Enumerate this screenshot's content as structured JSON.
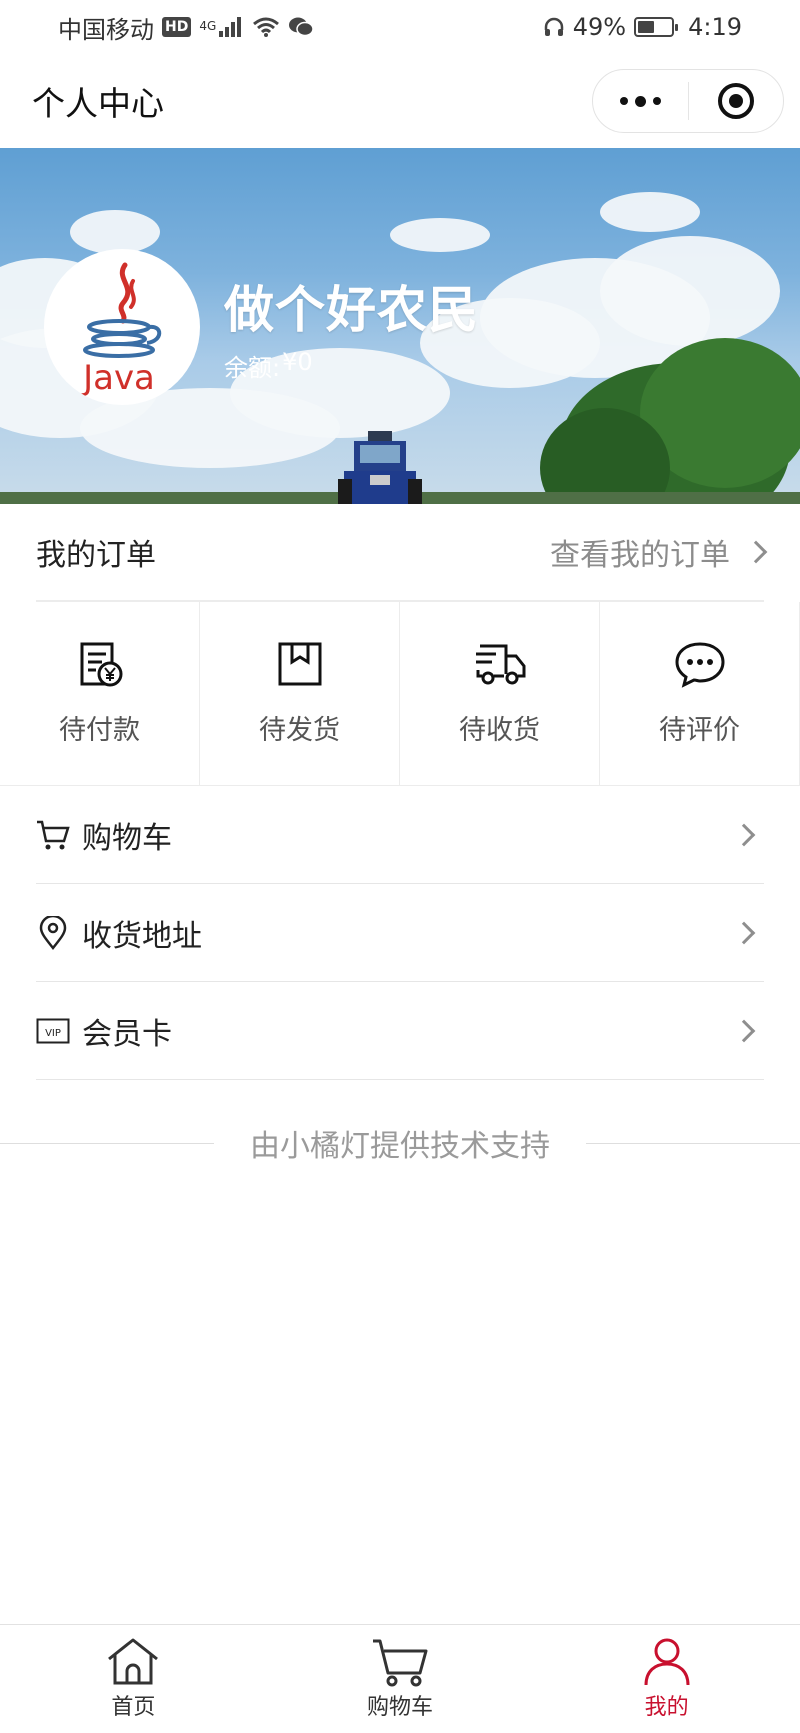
{
  "status_bar": {
    "carrier": "中国移动",
    "hd": "HD",
    "network": "4G",
    "battery": "49%",
    "battery_level": 0.49,
    "time": "4:19"
  },
  "nav": {
    "title": "个人中心"
  },
  "profile": {
    "avatar_text": "Java",
    "nickname": "做个好农民",
    "balance_label": "余额:",
    "balance_value": "¥0"
  },
  "orders": {
    "title": "我的订单",
    "view_all": "查看我的订单",
    "items": [
      {
        "label": "待付款",
        "icon": "payment-icon"
      },
      {
        "label": "待发货",
        "icon": "package-icon"
      },
      {
        "label": "待收货",
        "icon": "truck-icon"
      },
      {
        "label": "待评价",
        "icon": "comment-icon"
      }
    ]
  },
  "menu": {
    "items": [
      {
        "label": "购物车",
        "icon": "cart-icon"
      },
      {
        "label": "收货地址",
        "icon": "location-icon"
      },
      {
        "label": "会员卡",
        "icon": "vip-card-icon",
        "icon_text": "VIP"
      }
    ]
  },
  "support_text": "由小橘灯提供技术支持",
  "tab_bar": {
    "items": [
      {
        "label": "首页",
        "icon": "home-icon"
      },
      {
        "label": "购物车",
        "icon": "cart-icon"
      },
      {
        "label": "我的",
        "icon": "person-icon",
        "active": true
      }
    ],
    "active_color": "#c8102e"
  }
}
